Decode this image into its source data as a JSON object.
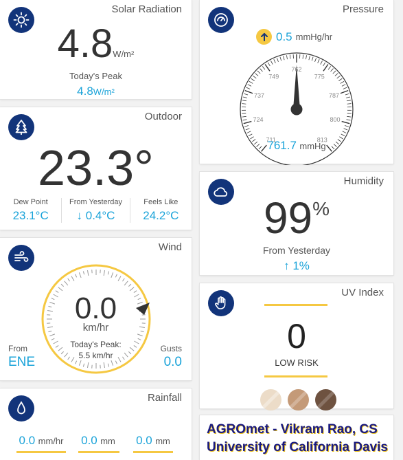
{
  "solar": {
    "title": "Solar Radiation",
    "value": "4.8",
    "unit": "W/m²",
    "peak_label": "Today's Peak",
    "peak_value": "4.8",
    "peak_unit": "W/m²"
  },
  "outdoor": {
    "title": "Outdoor",
    "temp": "23.3°",
    "stats": [
      {
        "label": "Dew Point",
        "value": "23.1°C"
      },
      {
        "label": "From Yesterday",
        "value": "↓ 0.4°C"
      },
      {
        "label": "Feels Like",
        "value": "24.2°C"
      }
    ]
  },
  "wind": {
    "title": "Wind",
    "speed": "0.0",
    "unit": "km/hr",
    "peak_label": "Today's Peak:",
    "peak_value": "5.5 km/hr",
    "from_label": "From",
    "from_value": "ENE",
    "gusts_label": "Gusts",
    "gusts_value": "0.0"
  },
  "rainfall": {
    "title": "Rainfall",
    "items": [
      {
        "value": "0.0",
        "unit": "mm/hr"
      },
      {
        "value": "0.0",
        "unit": "mm"
      },
      {
        "value": "0.0",
        "unit": "mm"
      }
    ]
  },
  "pressure": {
    "title": "Pressure",
    "trend_value": "0.5",
    "trend_unit": "mmHg/hr",
    "value": "761.7",
    "unit": "mmHg",
    "needle_value": 761.7,
    "dial_labels": [
      "711",
      "724",
      "737",
      "749",
      "762",
      "775",
      "787",
      "800",
      "813"
    ]
  },
  "humidity": {
    "title": "Humidity",
    "value": "99",
    "unit": "%",
    "from_label": "From Yesterday",
    "from_value": "↑ 1%"
  },
  "uv": {
    "title": "UV Index",
    "value": "0",
    "risk": "LOW RISK",
    "swatch_colors": [
      "#ecdcc8",
      "#c49a78",
      "#6e5240"
    ]
  },
  "footer": {
    "line1": "AGROmet - Vikram Rao, CS",
    "line2": "University of California Davis"
  },
  "colors": {
    "accent_blue": "#1aa3d9",
    "icon_navy": "#12347a",
    "gauge_yellow": "#f5c842"
  }
}
